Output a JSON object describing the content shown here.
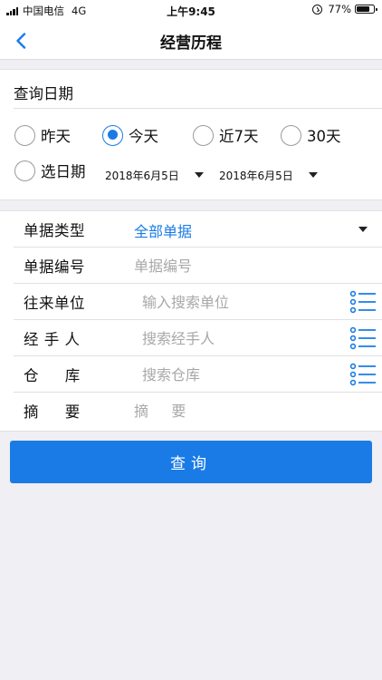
{
  "status_bar": {
    "carrier": "中国电信",
    "network": "4G",
    "time": "上午9:45",
    "battery_percent": "77%",
    "battery_level": 0.77
  },
  "nav": {
    "title": "经营历程",
    "back_icon": "chevron-left-icon"
  },
  "date_section": {
    "title": "查询日期",
    "options": [
      {
        "label": "昨天",
        "selected": false
      },
      {
        "label": "今天",
        "selected": true
      },
      {
        "label": "近7天",
        "selected": false
      },
      {
        "label": "30天",
        "selected": false
      },
      {
        "label": "选日期",
        "selected": false
      }
    ],
    "start_date": "2018年6月5日",
    "end_date": "2018年6月5日"
  },
  "form": {
    "doc_type": {
      "label": "单据类型",
      "value": "全部单据"
    },
    "doc_number": {
      "label": "单据编号",
      "placeholder": "单据编号"
    },
    "partner": {
      "label": "往来单位",
      "placeholder": "输入搜索单位"
    },
    "handler": {
      "label": "经 手 人",
      "placeholder": "搜索经手人"
    },
    "warehouse": {
      "label": "仓     库",
      "placeholder": "搜索仓库"
    },
    "summary": {
      "label": "摘     要",
      "placeholder": "摘     要"
    }
  },
  "query_button": {
    "label": "查询"
  },
  "colors": {
    "accent": "#1a7be6",
    "background": "#efeff4",
    "placeholder": "#a8a8a8"
  }
}
